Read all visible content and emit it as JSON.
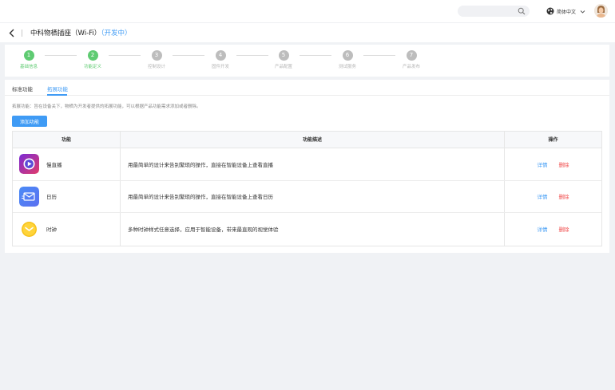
{
  "header": {
    "search_placeholder": "",
    "language": "简体中文"
  },
  "title_bar": {
    "product_name": "中科物栖插座（Wi-Fi）",
    "status": "（开发中）"
  },
  "steps": [
    {
      "number": "1",
      "label": "基础信息",
      "done": true
    },
    {
      "number": "2",
      "label": "功能定义",
      "done": true
    },
    {
      "number": "3",
      "label": "控制设计",
      "done": false
    },
    {
      "number": "4",
      "label": "固件开发",
      "done": false
    },
    {
      "number": "5",
      "label": "产品配置",
      "done": false
    },
    {
      "number": "6",
      "label": "测试服务",
      "done": false
    },
    {
      "number": "7",
      "label": "产品发布",
      "done": false
    }
  ],
  "tabs": {
    "standard": "标准功能",
    "extended": "拓展功能"
  },
  "hint": "拓展功能：旨在设备关下，物栖为开发者提供的拓展功能，可以根据产品功能需求添加或者删除。",
  "add_button": "添加功能",
  "table": {
    "headers": {
      "feature": "功能",
      "description": "功能描述",
      "action": "操作"
    },
    "rows": [
      {
        "name": "慢直播",
        "icon": "live-broadcast-icon",
        "description": "用最简单的设计来告别繁琐的操作，直接在智能设备上查看直播",
        "detail": "详情",
        "delete": "删除"
      },
      {
        "name": "日历",
        "icon": "calendar-mail-icon",
        "description": "用最简单的设计来告别繁琐的操作，直接在智能设备上查看日历",
        "detail": "详情",
        "delete": "删除"
      },
      {
        "name": "时钟",
        "icon": "clock-icon",
        "description": "多种时钟样式任意选择，应用于智能设备，带来最直观的视觉体验",
        "detail": "详情",
        "delete": "删除"
      }
    ]
  },
  "colors": {
    "accent": "#3f9bf5",
    "success": "#5fcb72",
    "danger": "#f04a4a"
  }
}
